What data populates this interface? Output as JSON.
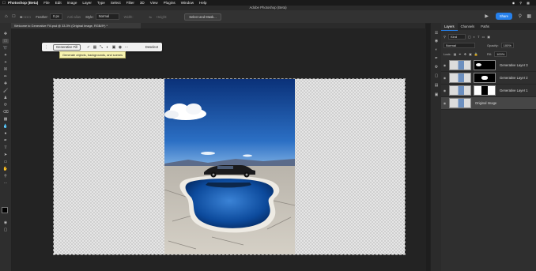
{
  "menubar": {
    "items": [
      "Photoshop (Beta)",
      "File",
      "Edit",
      "Image",
      "Layer",
      "Type",
      "Select",
      "Filter",
      "3D",
      "View",
      "Plugins",
      "Window",
      "Help"
    ]
  },
  "window": {
    "title": "Adobe Photoshop (Beta)"
  },
  "options": {
    "feather_label": "Feather:",
    "feather_value": "0 px",
    "antialias_label": "Anti-alias",
    "style_label": "Style:",
    "style_value": "Normal",
    "width_label": "Width:",
    "height_label": "Height:",
    "select_mask_label": "Select and Mask...",
    "share_label": "Share"
  },
  "document": {
    "tab_title": "Welcome to Generative Fill.psd @ 33.3% (Original Image, RGB/8*) *"
  },
  "context_bar": {
    "generative_fill_label": "Generative Fill",
    "deselect_label": "Deselect",
    "tooltip": "Generate objects, backgrounds, and scenes"
  },
  "panel": {
    "tabs": [
      "Layers",
      "Channels",
      "Paths"
    ],
    "active_tab": "Layers",
    "kind_label": "Kind",
    "blend_mode": "Normal",
    "opacity_label": "Opacity:",
    "opacity_value": "100%",
    "lock_label": "Lock:",
    "fill_label": "Fill:",
    "fill_value": "100%",
    "layers": [
      {
        "name": "Generative Layer 3",
        "selected": false,
        "has_mask": true
      },
      {
        "name": "Generative Layer 2",
        "selected": false,
        "has_mask": true
      },
      {
        "name": "Generative Layer 1",
        "selected": false,
        "has_mask": true
      },
      {
        "name": "Original Image",
        "selected": true,
        "has_mask": false
      }
    ]
  },
  "colors": {
    "accent": "#2680eb",
    "tooltip_bg": "#f7f3b0",
    "sky_top": "#0f3f8a",
    "water": "#1b5fb0"
  },
  "icons": [
    "apple-icon",
    "move-tool-icon",
    "marquee-tool-icon",
    "lasso-tool-icon",
    "crop-tool-icon",
    "brush-tool-icon",
    "eraser-tool-icon",
    "type-tool-icon",
    "hand-tool-icon",
    "zoom-tool-icon",
    "eye-icon",
    "search-icon",
    "wifi-icon"
  ]
}
